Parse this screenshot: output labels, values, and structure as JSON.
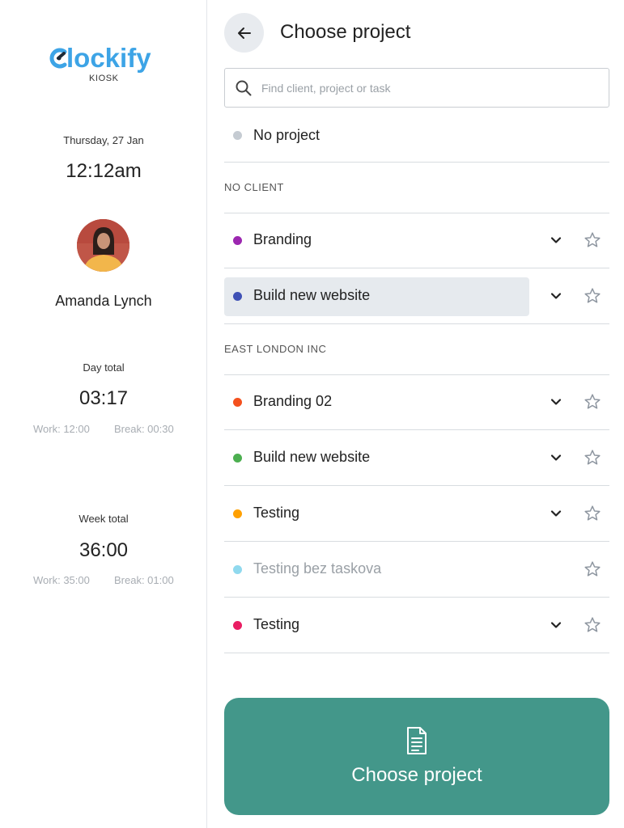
{
  "sidebar": {
    "logo": {
      "text": "Clockify",
      "sub": "KIOSK"
    },
    "date": "Thursday, 27 Jan",
    "time": "12:12am",
    "user_name": "Amanda Lynch",
    "day_total": {
      "label": "Day total",
      "value": "03:17",
      "work": "Work: 12:00",
      "break": "Break: 00:30"
    },
    "week_total": {
      "label": "Week total",
      "value": "36:00",
      "work": "Work: 35:00",
      "break": "Break: 01:00"
    }
  },
  "header": {
    "title": "Choose project",
    "back_icon": "arrow-left-icon"
  },
  "search": {
    "placeholder": "Find client, project or task",
    "value": ""
  },
  "no_project": {
    "label": "No project",
    "color": "#c5cbd2"
  },
  "groups": [
    {
      "title": "NO CLIENT",
      "projects": [
        {
          "name": "Branding",
          "color": "#9c27b0",
          "has_tasks": true,
          "selected": false,
          "muted": false
        },
        {
          "name": "Build new website",
          "color": "#3f51b5",
          "has_tasks": true,
          "selected": true,
          "muted": false
        }
      ]
    },
    {
      "title": "EAST LONDON INC",
      "projects": [
        {
          "name": "Branding 02",
          "color": "#f4511e",
          "has_tasks": true,
          "selected": false,
          "muted": false
        },
        {
          "name": "Build new website",
          "color": "#4caf50",
          "has_tasks": true,
          "selected": false,
          "muted": false
        },
        {
          "name": "Testing",
          "color": "#ffa000",
          "has_tasks": true,
          "selected": false,
          "muted": false
        },
        {
          "name": "Testing bez taskova",
          "color": "#90d9ee",
          "has_tasks": false,
          "selected": false,
          "muted": true
        },
        {
          "name": "Testing",
          "color": "#e91e63",
          "has_tasks": true,
          "selected": false,
          "muted": false
        }
      ]
    }
  ],
  "primary_button": {
    "label": "Choose project",
    "icon": "document-icon",
    "color": "#43978a"
  }
}
